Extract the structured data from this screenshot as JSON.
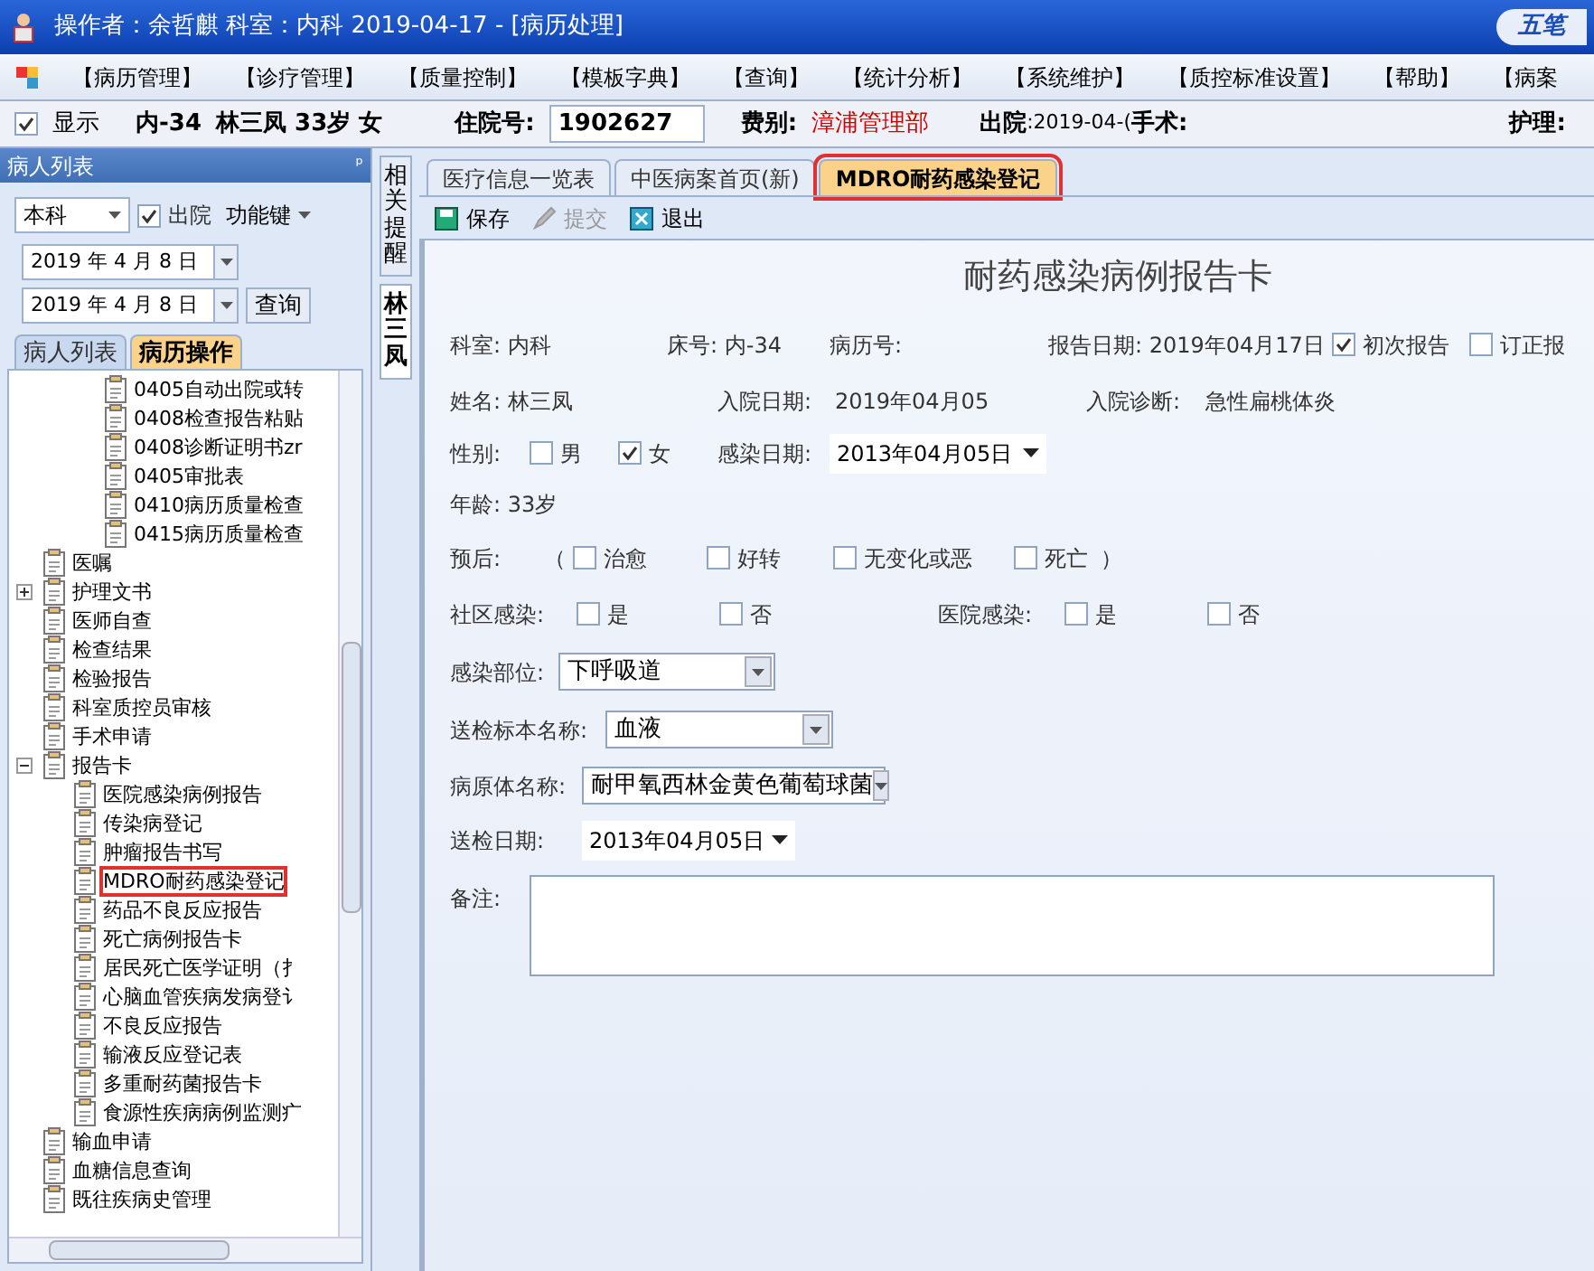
{
  "window": {
    "title": "操作者：余哲麒  科室：内科  2019-04-17 - [病历处理]",
    "logo": "五笔"
  },
  "menu": [
    "【病历管理】",
    "【诊疗管理】",
    "【质量控制】",
    "【模板字典】",
    "【查询】",
    "【统计分析】",
    "【系统维护】",
    "【质控标准设置】",
    "【帮助】",
    "【病案"
  ],
  "patient_bar": {
    "show_checked": true,
    "show_label": "显示",
    "bed": "内-34",
    "name_info": "林三凤 33岁 女",
    "admission_label": "住院号:",
    "admission_no": "1902627",
    "fee_label": "费别:",
    "fee": "漳浦管理部",
    "discharge_label": "出院",
    "discharge": ":2019-04-(",
    "surgery_label": "手术:",
    "nursing_label": "护理:"
  },
  "left_panel": {
    "title": "病人列表",
    "pin": "ᵖ",
    "dept": "本科",
    "discharged_checked": true,
    "discharged_label": "出院",
    "function_key": "功能键",
    "date_from": "2019 年 4 月 8 日",
    "date_to": "2019 年 4 月 8 日",
    "query": "查询",
    "tabs": [
      {
        "label": "病人列表",
        "selected": false
      },
      {
        "label": "病历操作",
        "selected": true
      }
    ],
    "tree": [
      {
        "children": [
          {
            "label": "0405自动出院或转"
          },
          {
            "label": "0408检查报告粘贴"
          },
          {
            "label": "0408诊断证明书zr"
          },
          {
            "label": "0405审批表"
          },
          {
            "label": "0410病历质量检查"
          },
          {
            "label": "0415病历质量检查"
          }
        ]
      },
      {
        "label": "医嘱"
      },
      {
        "label": "护理文书",
        "expanded": false
      },
      {
        "label": "医师自查"
      },
      {
        "label": "检查结果"
      },
      {
        "label": "检验报告"
      },
      {
        "label": "科室质控员审核"
      },
      {
        "label": "手术申请"
      },
      {
        "label": "报告卡",
        "expanded": true,
        "children": [
          {
            "label": "医院感染病例报告"
          },
          {
            "label": "传染病登记"
          },
          {
            "label": "肿瘤报告书写"
          },
          {
            "label": "MDRO耐药感染登记",
            "highlighted": true
          },
          {
            "label": "药品不良反应报告"
          },
          {
            "label": "死亡病例报告卡"
          },
          {
            "label": "居民死亡医学证明（扌"
          },
          {
            "label": "心脑血管疾病发病登讠"
          },
          {
            "label": "不良反应报告"
          },
          {
            "label": "输液反应登记表"
          },
          {
            "label": "多重耐药菌报告卡"
          },
          {
            "label": "食源性疾病病例监测疒"
          }
        ]
      },
      {
        "label": "输血申请"
      },
      {
        "label": "血糖信息查询"
      },
      {
        "label": "既往疾病史管理"
      }
    ]
  },
  "side_tabs": [
    {
      "label": "相关提醒",
      "selected": false
    },
    {
      "label": "林三凤",
      "selected": true
    }
  ],
  "doc_tabs": [
    {
      "label": "医疗信息一览表",
      "selected": false,
      "highlighted": false
    },
    {
      "label": "中医病案首页(新)",
      "selected": false,
      "highlighted": false
    },
    {
      "label": "MDRO耐药感染登记",
      "selected": true,
      "highlighted": true
    }
  ],
  "toolbar": [
    {
      "label": "保存",
      "disabled": false
    },
    {
      "label": "提交",
      "disabled": true
    },
    {
      "label": "退出",
      "disabled": false
    }
  ],
  "form": {
    "title": "耐药感染病例报告卡",
    "dept": "科室: 内科",
    "bed": "床号: 内-34",
    "record_no": "病历号:",
    "report_date": "报告日期: 2019年04月17日",
    "report_types": [
      {
        "label": "初次报告",
        "checked": true
      },
      {
        "label": "订正报",
        "checked": false
      }
    ],
    "name": "姓名: 林三凤",
    "admit_date_label": "入院日期:",
    "admit_date": "2019年04月05",
    "admit_diag_label": "入院诊断:",
    "admit_diag": "急性扁桃体炎",
    "sex_label": "性别:",
    "sex": [
      {
        "label": "男",
        "checked": false
      },
      {
        "label": "女",
        "checked": true
      }
    ],
    "infect_date_label": "感染日期:",
    "infect_date": "2013年04月05日",
    "age": "年龄: 33岁",
    "prognosis_label": "预后:",
    "paren_open": "（",
    "prognosis": [
      {
        "label": "治愈",
        "checked": false
      },
      {
        "label": "好转",
        "checked": false
      },
      {
        "label": "无变化或恶",
        "checked": false
      },
      {
        "label": "死亡",
        "checked": false
      }
    ],
    "paren_close": "）",
    "community_label": "社区感染:",
    "community": [
      {
        "label": "是",
        "checked": false
      },
      {
        "label": "否",
        "checked": false
      }
    ],
    "hospital_label": "医院感染:",
    "hospital": [
      {
        "label": "是",
        "checked": false
      },
      {
        "label": "否",
        "checked": false
      }
    ],
    "site_label": "感染部位:",
    "site": "下呼吸道",
    "specimen_label": "送检标本名称:",
    "specimen": "血液",
    "pathogen_label": "病原体名称:",
    "pathogen": "耐甲氧西林金黄色葡萄球菌",
    "send_date_label": "送检日期:",
    "send_date": "2013年04月05日",
    "remarks_label": "备注:"
  }
}
